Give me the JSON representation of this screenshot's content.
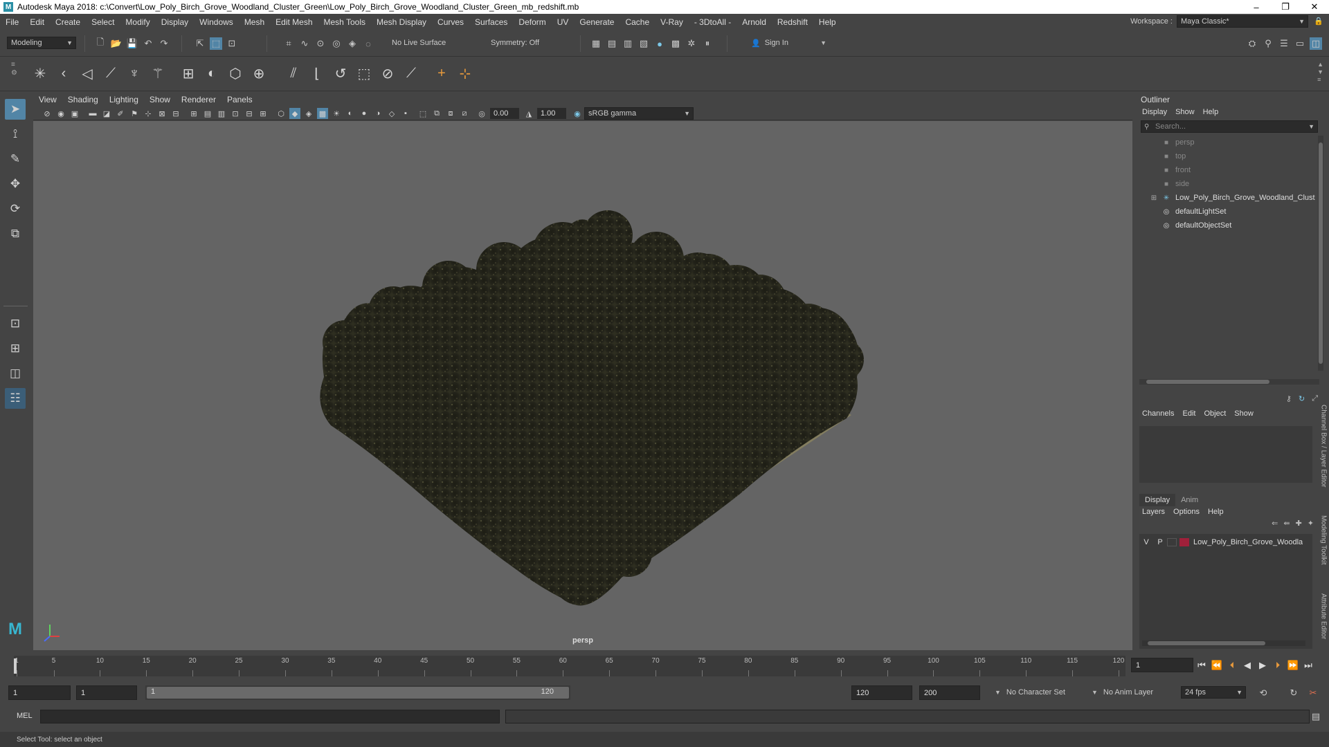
{
  "window": {
    "title": "Autodesk Maya 2018: c:\\Convert\\Low_Poly_Birch_Grove_Woodland_Cluster_Green\\Low_Poly_Birch_Grove_Woodland_Cluster_Green_mb_redshift.mb",
    "minimize": "–",
    "maximize": "❐",
    "close": "✕"
  },
  "menubar": {
    "items": [
      "File",
      "Edit",
      "Create",
      "Select",
      "Modify",
      "Display",
      "Windows",
      "Mesh",
      "Edit Mesh",
      "Mesh Tools",
      "Mesh Display",
      "Curves",
      "Surfaces",
      "Deform",
      "UV",
      "Generate",
      "Cache",
      "V-Ray",
      "- 3DtoAll -",
      "Arnold",
      "Redshift",
      "Help"
    ],
    "workspace_label": "Workspace :",
    "workspace_value": "Maya Classic*"
  },
  "statusline": {
    "mode": "Modeling",
    "live_surface": "No Live Surface",
    "symmetry": "Symmetry: Off",
    "sign_in": "Sign In"
  },
  "viewport": {
    "menu": [
      "View",
      "Shading",
      "Lighting",
      "Show",
      "Renderer",
      "Panels"
    ],
    "exposure": "0.00",
    "gamma": "1.00",
    "color_space": "sRGB gamma",
    "camera": "persp"
  },
  "outliner": {
    "title": "Outliner",
    "menu": [
      "Display",
      "Show",
      "Help"
    ],
    "search_placeholder": "Search...",
    "items": [
      {
        "label": "persp",
        "icon": "camera-icon",
        "dim": true
      },
      {
        "label": "top",
        "icon": "camera-icon",
        "dim": true
      },
      {
        "label": "front",
        "icon": "camera-icon",
        "dim": true
      },
      {
        "label": "side",
        "icon": "camera-icon",
        "dim": true
      },
      {
        "label": "Low_Poly_Birch_Grove_Woodland_Clust",
        "icon": "transform-icon",
        "dim": false,
        "expandable": true
      },
      {
        "label": "defaultLightSet",
        "icon": "set-icon",
        "dim": false
      },
      {
        "label": "defaultObjectSet",
        "icon": "set-icon",
        "dim": false
      }
    ]
  },
  "channelbox": {
    "menu": [
      "Channels",
      "Edit",
      "Object",
      "Show"
    ],
    "layer_tabs": [
      "Display",
      "Anim"
    ],
    "layer_menu": [
      "Layers",
      "Options",
      "Help"
    ],
    "layer": {
      "v": "V",
      "p": "P",
      "name": "Low_Poly_Birch_Grove_Woodla",
      "color": "#a0203a"
    },
    "side_tabs": [
      "Channel Box / Layer Editor",
      "Modeling Toolkit",
      "Attribute Editor"
    ]
  },
  "timeslider": {
    "ticks": [
      "1",
      "5",
      "10",
      "15",
      "20",
      "25",
      "30",
      "35",
      "40",
      "45",
      "50",
      "55",
      "60",
      "65",
      "70",
      "75",
      "80",
      "85",
      "90",
      "95",
      "100",
      "105",
      "110",
      "115",
      "120"
    ],
    "current_frame": "1"
  },
  "range": {
    "start": "1",
    "playback_start": "1",
    "slider_start": "1",
    "slider_end": "120",
    "playback_end": "120",
    "end": "200",
    "character_set": "No Character Set",
    "anim_layer": "No Anim Layer",
    "fps": "24 fps"
  },
  "cmdline": {
    "label": "MEL"
  },
  "helpline": {
    "text": "Select Tool: select an object"
  },
  "colors": {
    "accent": "#5285a6",
    "viewport_bg": "#646464",
    "panel_bg": "#444444"
  }
}
